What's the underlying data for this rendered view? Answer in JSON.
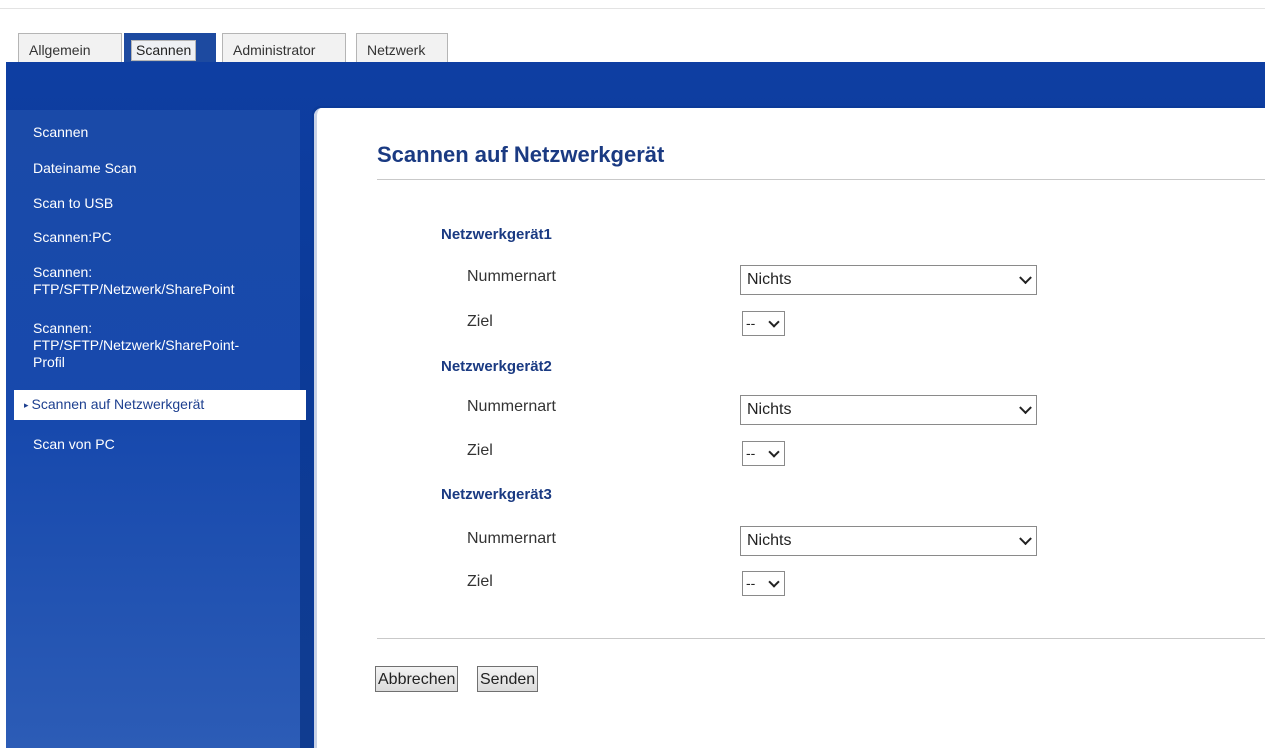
{
  "tabs": [
    {
      "label": "Allgemein",
      "active": false
    },
    {
      "label": "Scannen",
      "active": true
    },
    {
      "label": "Administrator",
      "active": false
    },
    {
      "label": "Netzwerk",
      "active": false
    }
  ],
  "sidebar": {
    "items": [
      {
        "label": "Scannen"
      },
      {
        "label": "Dateiname Scan"
      },
      {
        "label": "Scan to USB"
      },
      {
        "label": "Scannen:PC"
      },
      {
        "label_line1": "Scannen:",
        "label_line2": "FTP/SFTP/Netzwerk/SharePoint"
      },
      {
        "label_line1": "Scannen:",
        "label_line2": "FTP/SFTP/Netzwerk/SharePoint-",
        "label_line3": "Profil"
      },
      {
        "label": "Scannen auf Netzwerkgerät",
        "active": true,
        "marker": "▸"
      },
      {
        "label": "Scan von PC"
      }
    ]
  },
  "main": {
    "title": "Scannen auf Netzwerkgerät",
    "sections": [
      {
        "heading": "Netzwerkgerät1",
        "number_type_label": "Nummernart",
        "number_type_value": "Nichts",
        "target_label": "Ziel",
        "target_value": "--"
      },
      {
        "heading": "Netzwerkgerät2",
        "number_type_label": "Nummernart",
        "number_type_value": "Nichts",
        "target_label": "Ziel",
        "target_value": "--"
      },
      {
        "heading": "Netzwerkgerät3",
        "number_type_label": "Nummernart",
        "number_type_value": "Nichts",
        "target_label": "Ziel",
        "target_value": "--"
      }
    ],
    "buttons": {
      "cancel_label": "Abbrechen",
      "submit_label": "Senden"
    }
  },
  "colors": {
    "brand_blue": "#1d4aa0",
    "heading_blue": "#1a3a82"
  }
}
